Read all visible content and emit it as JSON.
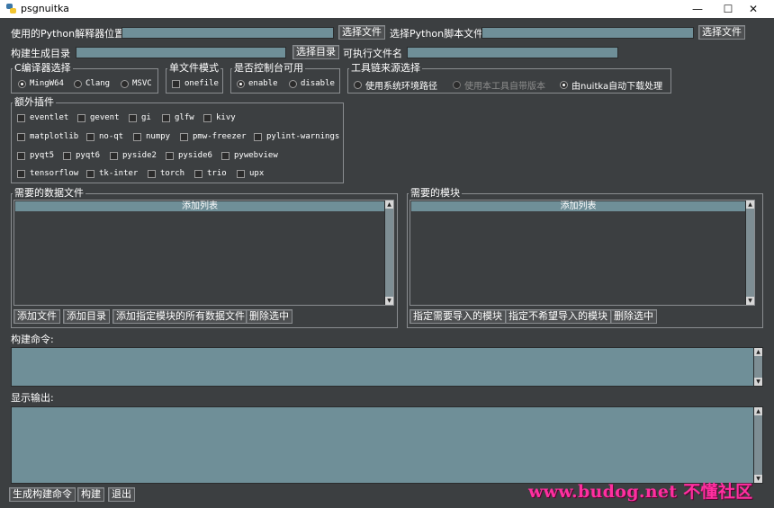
{
  "window": {
    "title": "psgnuitka",
    "minimize": "—",
    "maximize": "☐",
    "close": "✕"
  },
  "row1": {
    "python_label": "使用的Python解释器位置",
    "python_value": "",
    "python_button": "选择文件",
    "script_label": "选择Python脚本文件",
    "script_value": "",
    "script_button": "选择文件"
  },
  "row2": {
    "build_dir_label": "构建生成目录",
    "build_dir_value": "",
    "build_dir_button": "选择目录",
    "exe_name_label": "可执行文件名",
    "exe_name_value": ""
  },
  "compiler": {
    "title": "C编译器选择",
    "options": [
      "MingW64",
      "Clang",
      "MSVC"
    ],
    "selected": "MingW64"
  },
  "single_file": {
    "title": "单文件模式",
    "option": "onefile",
    "checked": false
  },
  "console": {
    "title": "是否控制台可用",
    "options": [
      "enable",
      "disable"
    ],
    "selected": "enable"
  },
  "toolchain": {
    "title": "工具链来源选择",
    "options": [
      "使用系统环境路径",
      "使用本工具自带版本",
      "由nuitka自动下载处理"
    ],
    "selected": "由nuitka自动下载处理",
    "disabled": "使用本工具自带版本"
  },
  "plugins": {
    "title": "额外插件",
    "rows": [
      [
        "eventlet",
        "gevent",
        "gi",
        "glfw",
        "kivy"
      ],
      [
        "matplotlib",
        "no-qt",
        "numpy",
        "pmw-freezer",
        "pylint-warnings"
      ],
      [
        "pyqt5",
        "pyqt6",
        "pyside2",
        "pyside6",
        "pywebview"
      ],
      [
        "tensorflow",
        "tk-inter",
        "torch",
        "trio",
        "upx"
      ]
    ]
  },
  "data_files": {
    "title": "需要的数据文件",
    "list_header": "添加列表",
    "buttons": [
      "添加文件",
      "添加目录",
      "添加指定模块的所有数据文件",
      "删除选中"
    ]
  },
  "modules": {
    "title": "需要的模块",
    "list_header": "添加列表",
    "buttons": [
      "指定需要导入的模块",
      "指定不希望导入的模块",
      "删除选中"
    ]
  },
  "build_command": {
    "label": "构建命令:",
    "value": ""
  },
  "output": {
    "label": "显示输出:",
    "value": ""
  },
  "bottom_buttons": [
    "生成构建命令",
    "构建",
    "退出"
  ],
  "watermark": "www.budog.net 不懂社区"
}
